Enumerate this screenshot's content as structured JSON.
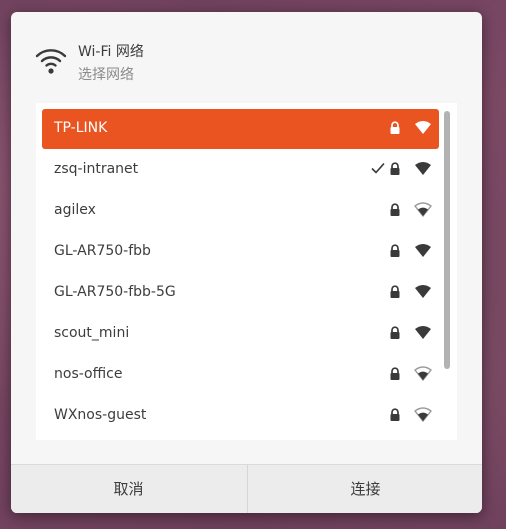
{
  "dialog": {
    "title": "Wi-Fi 网络",
    "subtitle": "选择网络",
    "header_icon": "wifi-icon"
  },
  "networks": [
    {
      "name": "TP-LINK",
      "connected": false,
      "secured": true,
      "signal": "full",
      "selected": true
    },
    {
      "name": "zsq-intranet",
      "connected": true,
      "secured": true,
      "signal": "full",
      "selected": false
    },
    {
      "name": "agilex",
      "connected": false,
      "secured": true,
      "signal": "medium",
      "selected": false
    },
    {
      "name": "GL-AR750-fbb",
      "connected": false,
      "secured": true,
      "signal": "full",
      "selected": false
    },
    {
      "name": "GL-AR750-fbb-5G",
      "connected": false,
      "secured": true,
      "signal": "full",
      "selected": false
    },
    {
      "name": "scout_mini",
      "connected": false,
      "secured": true,
      "signal": "full",
      "selected": false
    },
    {
      "name": "nos-office",
      "connected": false,
      "secured": true,
      "signal": "medium",
      "selected": false
    },
    {
      "name": "WXnos-guest",
      "connected": false,
      "secured": true,
      "signal": "medium",
      "selected": false
    }
  ],
  "buttons": {
    "cancel": "取消",
    "connect": "连接"
  },
  "colors": {
    "accent": "#e95420",
    "background": "#f6f6f6",
    "list_background": "#ffffff"
  }
}
